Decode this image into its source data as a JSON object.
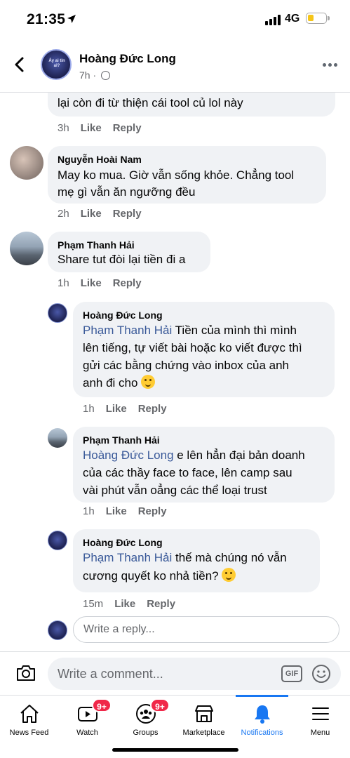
{
  "status_bar": {
    "time": "21:35",
    "network": "4G",
    "battery_color": "#f5c518"
  },
  "header": {
    "name": "Hoàng Đức Long",
    "time": "7h ·",
    "avatar_text": "Ấy ai\ntin ai?"
  },
  "comments": [
    {
      "text": "lại còn đi từ thiện cái tool củ lol này",
      "time": "3h",
      "like": "Like",
      "reply": "Reply"
    },
    {
      "name": "Nguyễn Hoài Nam",
      "line1": "May ko mua. Giờ vẫn sống khỏe. Chẳng tool",
      "line2": "mẹ gì vẫn ăn ngưỡng đều",
      "time": "2h",
      "like": "Like",
      "reply": "Reply"
    },
    {
      "name": "Phạm Thanh Hải",
      "text": "Share tut đòi lại tiền đi a",
      "time": "1h",
      "like": "Like",
      "reply": "Reply"
    }
  ],
  "replies": [
    {
      "name": "Hoàng Đức Long",
      "mention": "Phạm Thanh Hải",
      "line1": " Tiền của mình thì mình",
      "line2": "lên tiếng, tự viết bài hoặc ko viết được thì",
      "line3": "gửi các bằng chứng vào inbox của anh",
      "line4": "anh đi cho",
      "time": "1h",
      "like": "Like",
      "reply": "Reply"
    },
    {
      "name": "Phạm Thanh Hải",
      "mention": "Hoàng Đức Long",
      "line1": " e lên hẳn đại bản doanh",
      "line2": "của các thầy face to face, lên camp sau",
      "line3": "vài phút vẫn oẳng các thể loại trust",
      "time": "1h",
      "like": "Like",
      "reply": "Reply"
    },
    {
      "name": "Hoàng Đức Long",
      "mention": "Phạm Thanh Hải",
      "line1": " thế mà chúng nó vẫn",
      "line2": "cương quyết ko nhả tiền?",
      "time": "15m",
      "like": "Like",
      "reply": "Reply"
    }
  ],
  "reply_input": {
    "placeholder": "Write a reply..."
  },
  "comment_bar": {
    "placeholder": "Write a comment...",
    "gif_label": "GIF"
  },
  "tabs": [
    {
      "label": "News Feed",
      "icon": "home-icon"
    },
    {
      "label": "Watch",
      "icon": "watch-icon",
      "badge": "9+"
    },
    {
      "label": "Groups",
      "icon": "groups-icon",
      "badge": "9+"
    },
    {
      "label": "Marketplace",
      "icon": "marketplace-icon"
    },
    {
      "label": "Notifications",
      "icon": "bell-icon"
    },
    {
      "label": "Menu",
      "icon": "menu-icon"
    }
  ],
  "colors": {
    "accent": "#1877f2",
    "mention": "#385898",
    "badge": "#f02849",
    "bubble": "#f0f2f5"
  }
}
